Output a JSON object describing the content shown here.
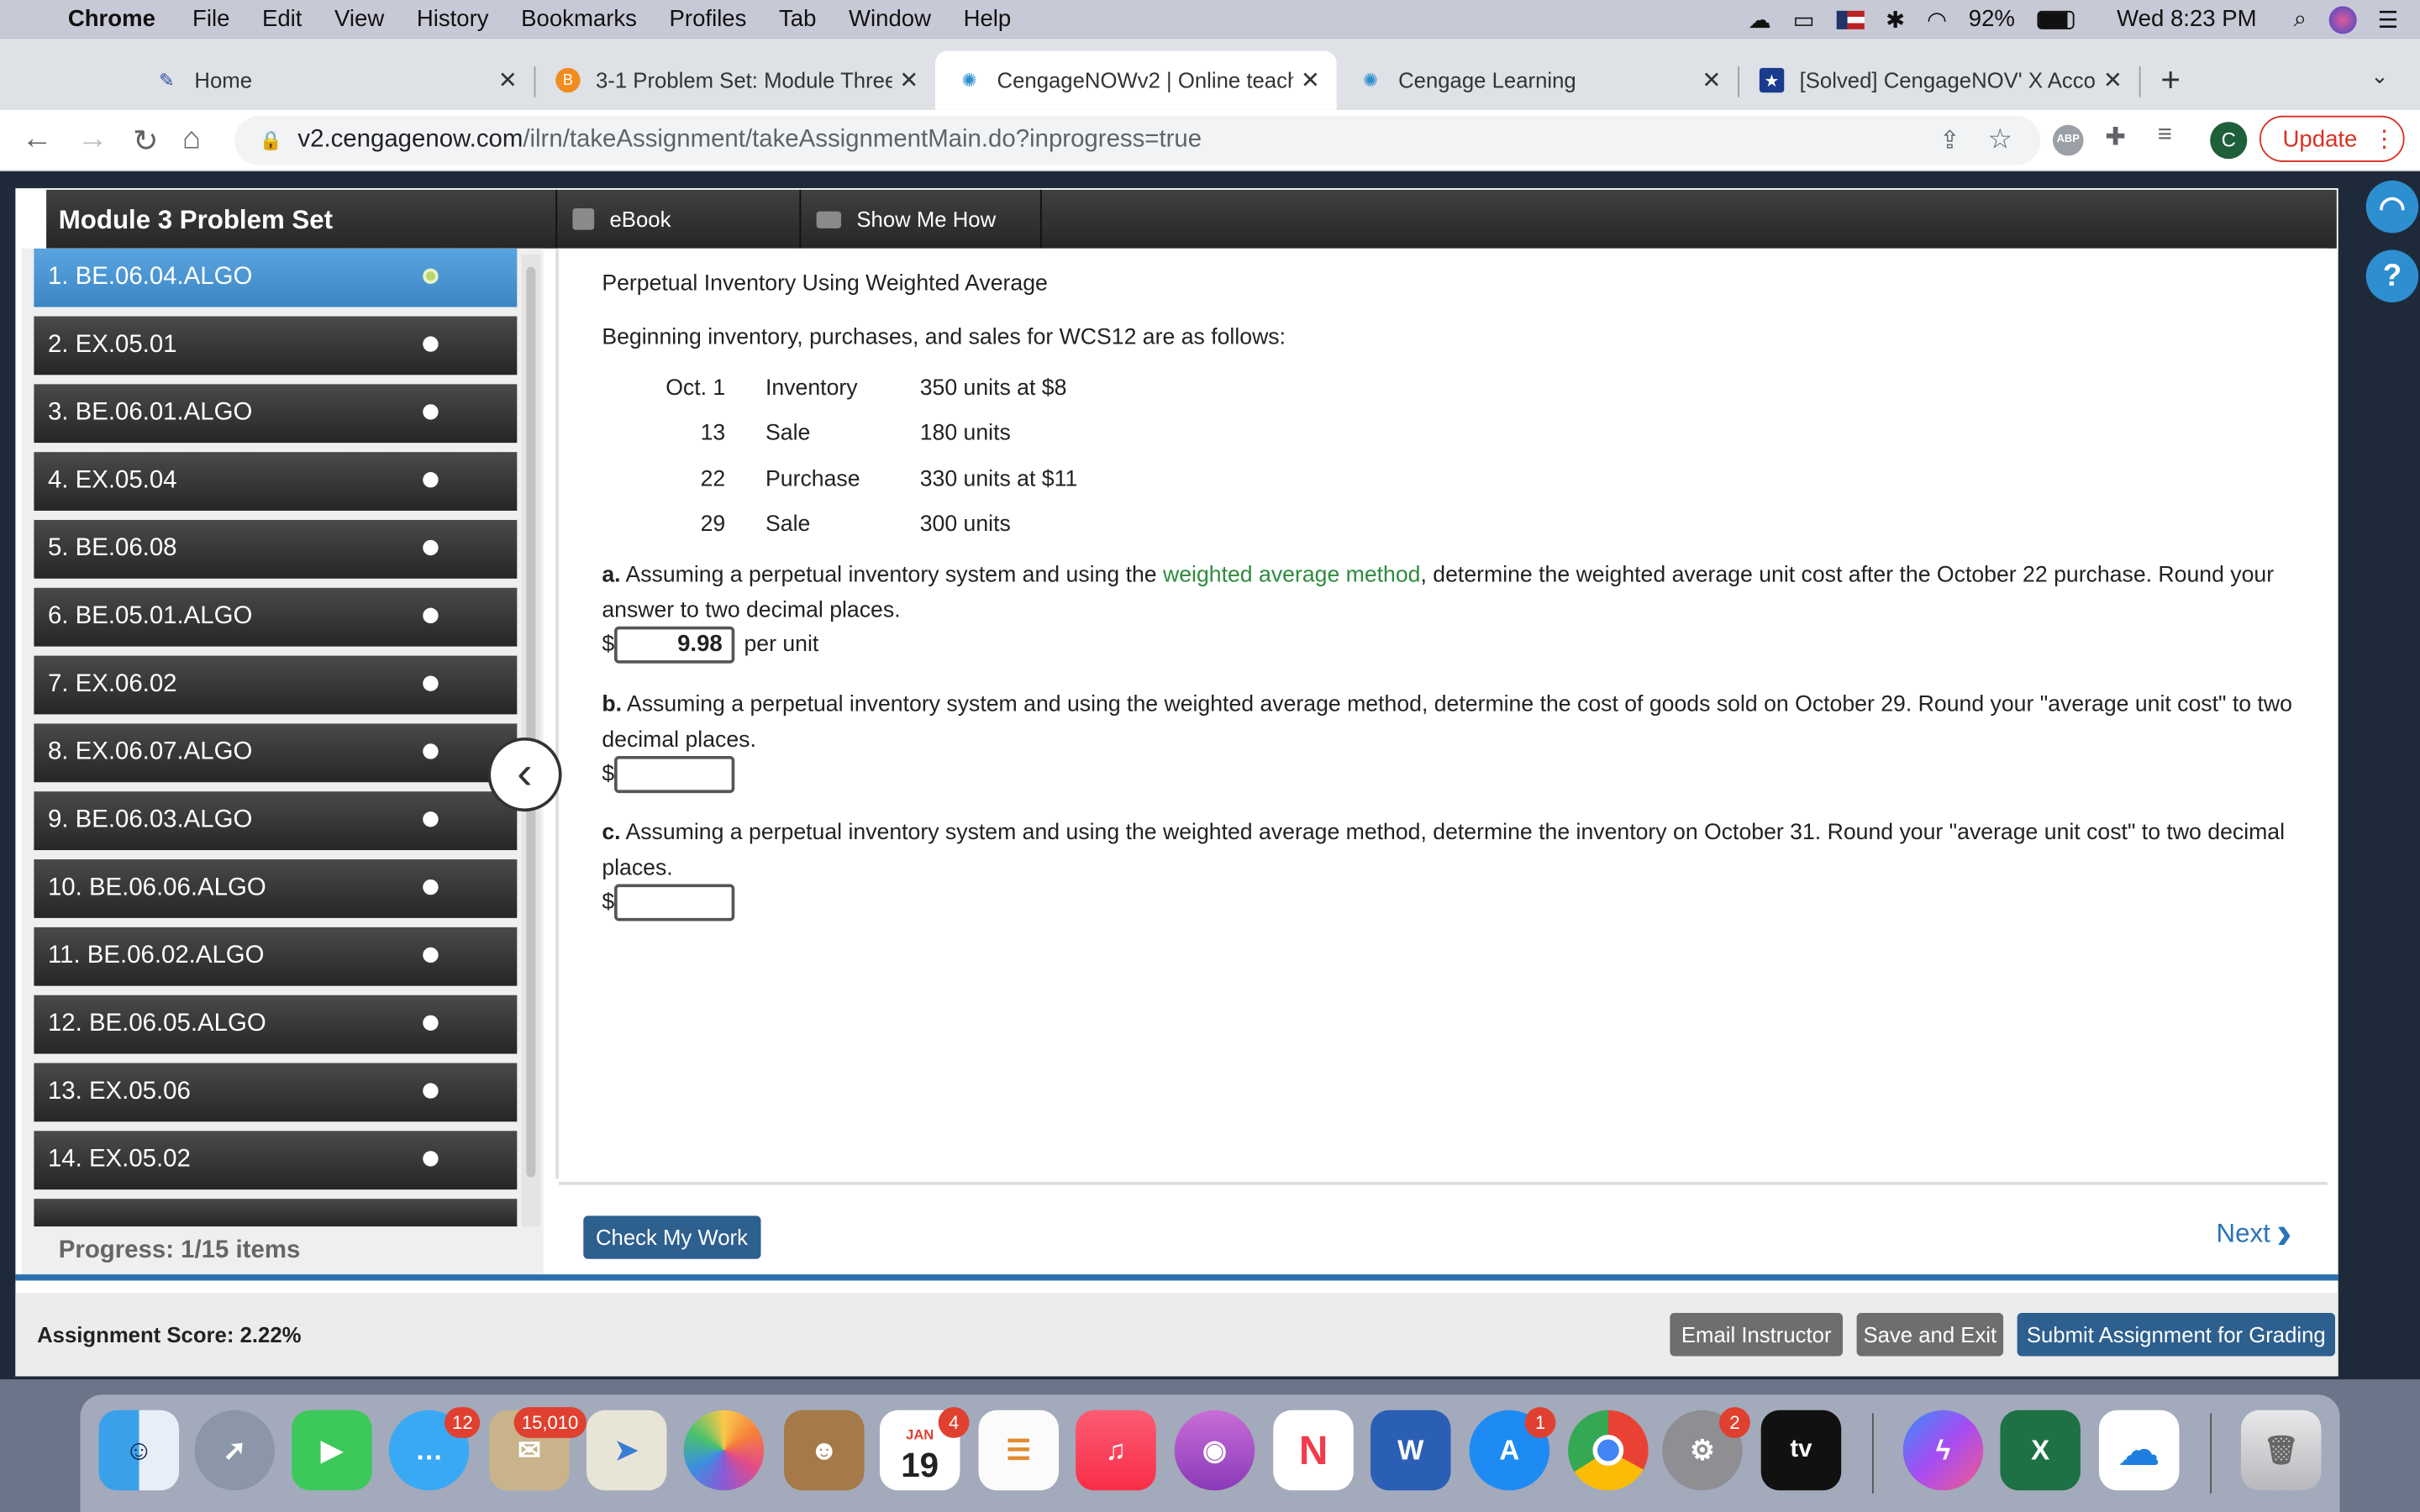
{
  "menubar": {
    "app": "Chrome",
    "items": [
      "File",
      "Edit",
      "View",
      "History",
      "Bookmarks",
      "Profiles",
      "Tab",
      "Window",
      "Help"
    ],
    "battery": "92%",
    "clock": "Wed 8:23 PM"
  },
  "tabs": [
    {
      "title": "Home"
    },
    {
      "title": "3-1 Problem Set: Module Three"
    },
    {
      "title": "CengageNOWv2 | Online teach"
    },
    {
      "title": "Cengage Learning"
    },
    {
      "title": "[Solved] CengageNOV' X Acco"
    }
  ],
  "address": {
    "host": "v2.cengagenow.com",
    "path": "/ilrn/takeAssignment/takeAssignmentMain.do?inprogress=true"
  },
  "toolbar": {
    "profile_initial": "C",
    "update_label": "Update"
  },
  "header": {
    "title": "Module 3 Problem Set",
    "ebook": "eBook",
    "show_me_how": "Show Me How"
  },
  "sidebar": {
    "items": [
      {
        "label": "1. BE.06.04.ALGO"
      },
      {
        "label": "2. EX.05.01"
      },
      {
        "label": "3. BE.06.01.ALGO"
      },
      {
        "label": "4. EX.05.04"
      },
      {
        "label": "5. BE.06.08"
      },
      {
        "label": "6. BE.05.01.ALGO"
      },
      {
        "label": "7. EX.06.02"
      },
      {
        "label": "8. EX.06.07.ALGO"
      },
      {
        "label": "9. BE.06.03.ALGO"
      },
      {
        "label": "10. BE.06.06.ALGO"
      },
      {
        "label": "11. BE.06.02.ALGO"
      },
      {
        "label": "12. BE.06.05.ALGO"
      },
      {
        "label": "13. EX.05.06"
      },
      {
        "label": "14. EX.05.02"
      }
    ],
    "progress": "Progress:  1/15 items"
  },
  "problem": {
    "title": "Perpetual Inventory Using Weighted Average",
    "intro": "Beginning inventory, purchases, and sales for WCS12 are as follows:",
    "rows": [
      {
        "date": "Oct. 1",
        "type": "Inventory",
        "detail": "350 units at $8"
      },
      {
        "date": "13",
        "type": "Sale",
        "detail": "180 units"
      },
      {
        "date": "22",
        "type": "Purchase",
        "detail": "330 units at $11"
      },
      {
        "date": "29",
        "type": "Sale",
        "detail": "300 units"
      }
    ],
    "a_letter": "a.",
    "a_pre": " Assuming a perpetual inventory system and using the ",
    "a_link": "weighted average method",
    "a_post": ", determine the weighted average unit cost after the October 22 purchase. Round your answer to two decimal places.",
    "a_value": "9.98",
    "a_unit": "per unit",
    "b_letter": "b.",
    "b_text": " Assuming a perpetual inventory system and using the weighted average method, determine the cost of goods sold on October 29. Round your \"average unit cost\" to two decimal places.",
    "c_letter": "c.",
    "c_text": " Assuming a perpetual inventory system and using the weighted average method, determine the inventory on October 31. Round your \"average unit cost\" to two decimal places.",
    "currency": "$"
  },
  "footer": {
    "check": "Check My Work",
    "next": "Next",
    "score": "Assignment Score: 2.22%",
    "email": "Email Instructor",
    "save": "Save and Exit",
    "submit": "Submit Assignment for Grading"
  },
  "dock": {
    "messages_badge": "12",
    "mail_badge": "15,010",
    "calendar_badge": "4",
    "calendar_month": "JAN",
    "calendar_day": "19",
    "appstore_badge": "1",
    "settings_badge": "2"
  },
  "colors": {
    "accent": "#2d5f8f",
    "link_green": "#2e8b3e",
    "selected_item": "#4a97d6"
  }
}
